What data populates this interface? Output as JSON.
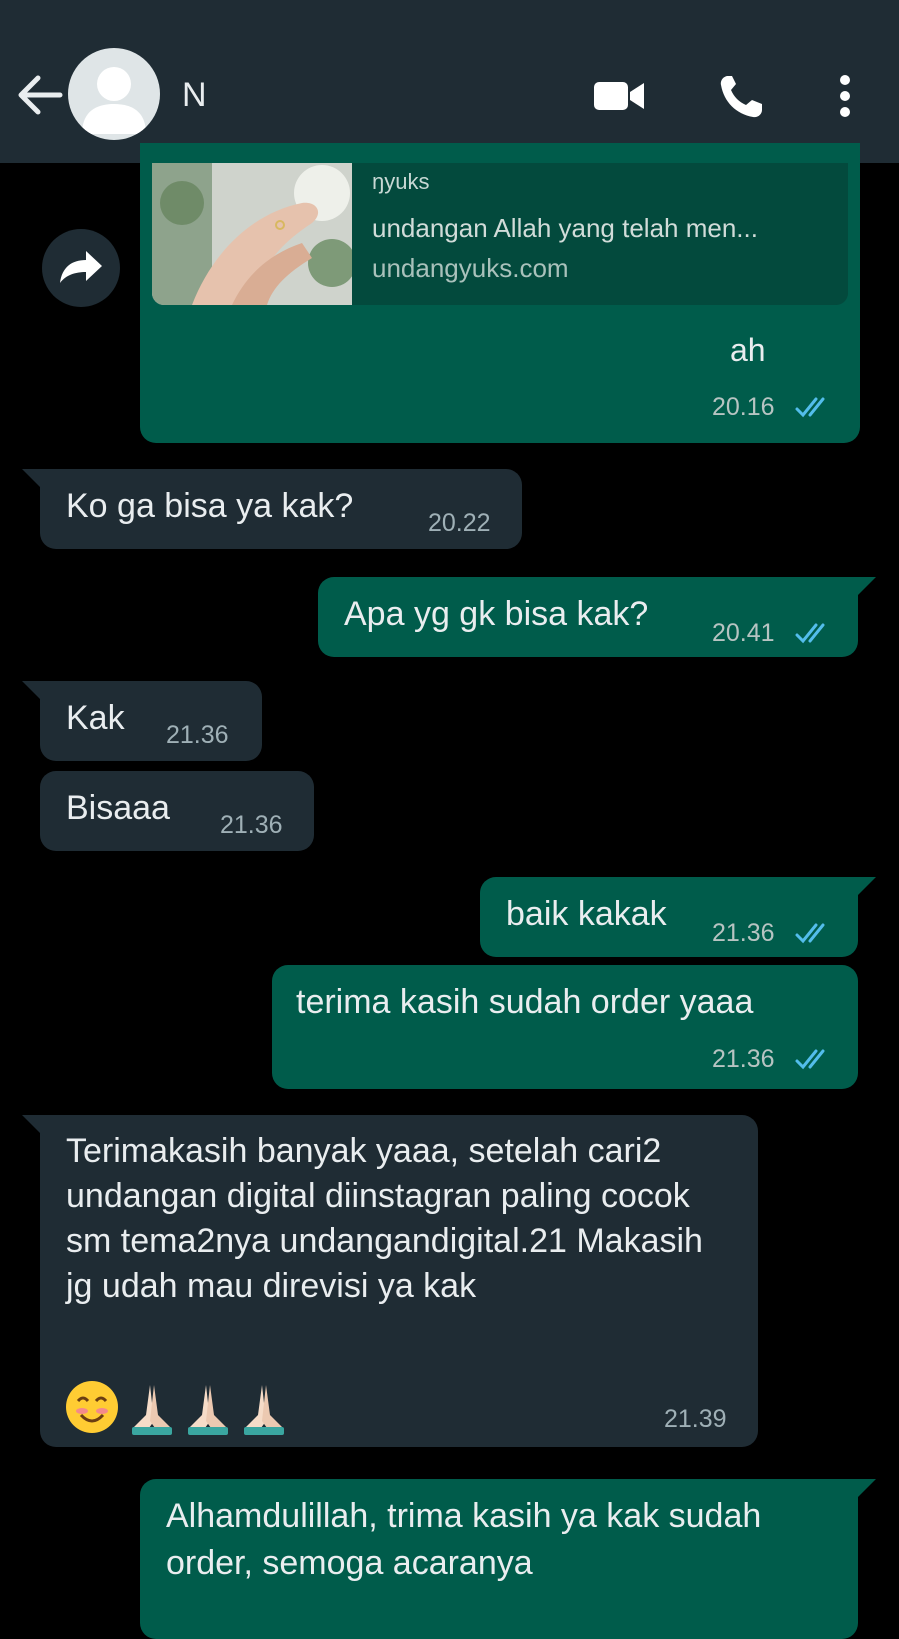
{
  "header": {
    "contact_name": "N",
    "back_icon": "arrow-left-icon",
    "video_icon": "video-camera-icon",
    "call_icon": "phone-icon",
    "menu_icon": "more-vertical-icon"
  },
  "colors": {
    "header_bg": "#1f2c34",
    "chat_bg": "#000000",
    "incoming_bubble": "#1f2c34",
    "outgoing_bubble": "#005c4b",
    "read_tick": "#53bdeb"
  },
  "link_preview": {
    "site_title": "ŋyuks",
    "description": "undangan Allah yang telah men...",
    "domain": "undangyuks.com",
    "caption_fragment": "ah",
    "time": "20.16"
  },
  "messages": [
    {
      "dir": "in",
      "text": "Ko ga bisa ya kak?",
      "time": "20.22"
    },
    {
      "dir": "out",
      "text": "Apa yg gk bisa kak?",
      "time": "20.41"
    },
    {
      "dir": "in",
      "text": "Kak",
      "time": "21.36"
    },
    {
      "dir": "in",
      "text": "Bisaaa",
      "time": "21.36"
    },
    {
      "dir": "out",
      "text": "baik kakak",
      "time": "21.36"
    },
    {
      "dir": "out",
      "text": "terima kasih sudah order yaaa",
      "time": "21.36"
    },
    {
      "dir": "in",
      "text": "Terimakasih banyak yaaa, setelah cari2 undangan digital diinstagran paling cocok sm tema2nya undangandigital.21 Makasih jg udah mau direvisi ya kak",
      "emoji": "😊🙏🏻🙏🏻🙏🏻",
      "time": "21.39"
    },
    {
      "dir": "out",
      "text": "Alhamdulillah, trima kasih ya kak sudah order, semoga acaranya",
      "time": ""
    }
  ]
}
